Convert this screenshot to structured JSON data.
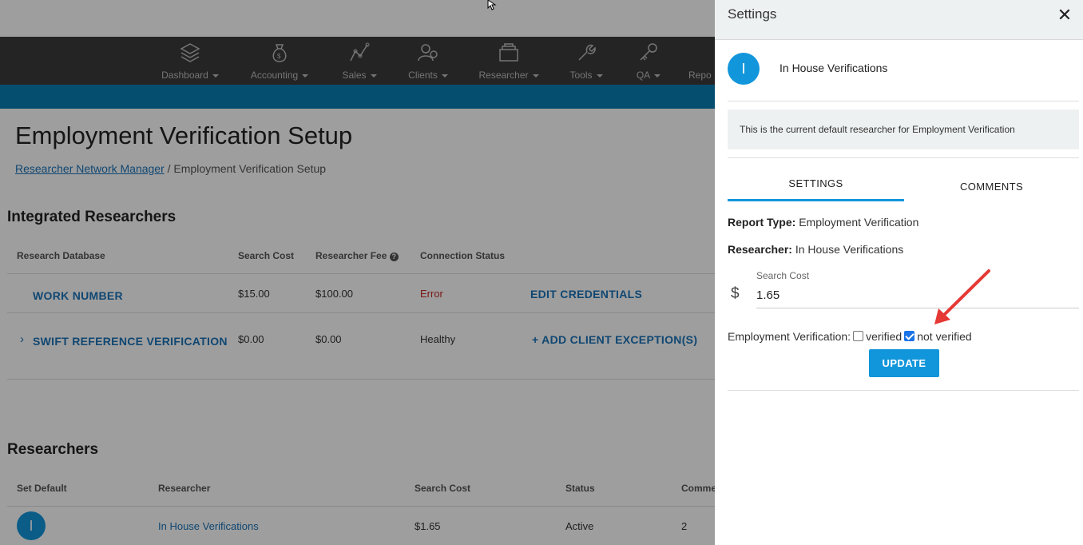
{
  "nav": {
    "items": [
      {
        "label": "Dashboard",
        "icon": "layers-icon"
      },
      {
        "label": "Accounting",
        "icon": "money-bag-icon"
      },
      {
        "label": "Sales",
        "icon": "chart-line-icon"
      },
      {
        "label": "Clients",
        "icon": "users-icon"
      },
      {
        "label": "Researcher",
        "icon": "stack-icon"
      },
      {
        "label": "Tools",
        "icon": "wrench-icon"
      },
      {
        "label": "QA",
        "icon": "key-icon"
      },
      {
        "label": "Repo",
        "icon": "report-icon"
      }
    ]
  },
  "page": {
    "title": "Employment Verification Setup",
    "breadcrumb_link": "Researcher Network Manager",
    "breadcrumb_sep": "/",
    "breadcrumb_current": "Employment Verification Setup"
  },
  "integrated": {
    "heading": "Integrated Researchers",
    "headers": [
      "Research Database",
      "Search Cost",
      "Researcher Fee",
      "Connection Status"
    ],
    "rows": [
      {
        "name": "WORK NUMBER",
        "cost": "$15.00",
        "fee": "$100.00",
        "status": "Error",
        "action": "EDIT CREDENTIALS"
      },
      {
        "name": "SWIFT REFERENCE VERIFICATION",
        "cost": "$0.00",
        "fee": "$0.00",
        "status": "Healthy",
        "action": "ADD CLIENT EXCEPTION(S)"
      }
    ]
  },
  "researchers": {
    "heading": "Researchers",
    "headers": [
      "Set Default",
      "Researcher",
      "Search Cost",
      "Status",
      "Comme"
    ],
    "rows": [
      {
        "avatar": "I",
        "name": "In House Verifications",
        "cost": "$1.65",
        "status": "Active",
        "comments": "2"
      }
    ]
  },
  "panel": {
    "title": "Settings",
    "avatar": "I",
    "researcher_name": "In House Verifications",
    "note": "This is the current default researcher for Employment Verification",
    "tabs": [
      "SETTINGS",
      "COMMENTS"
    ],
    "report_type_label": "Report Type:",
    "report_type_value": "Employment Verification",
    "researcher_label": "Researcher:",
    "researcher_value": "In House Verifications",
    "search_cost_label": "Search Cost",
    "currency": "$",
    "search_cost_value": "1.65",
    "ev_label": "Employment Verification:",
    "opt_verified": "verified",
    "opt_not_verified": "not verified",
    "update_label": "UPDATE"
  },
  "colors": {
    "accent": "#1296db",
    "nav_bg": "#3b3b3b",
    "band": "#0a7fb5",
    "error": "#c62828",
    "annotation_arrow": "#e53935"
  }
}
